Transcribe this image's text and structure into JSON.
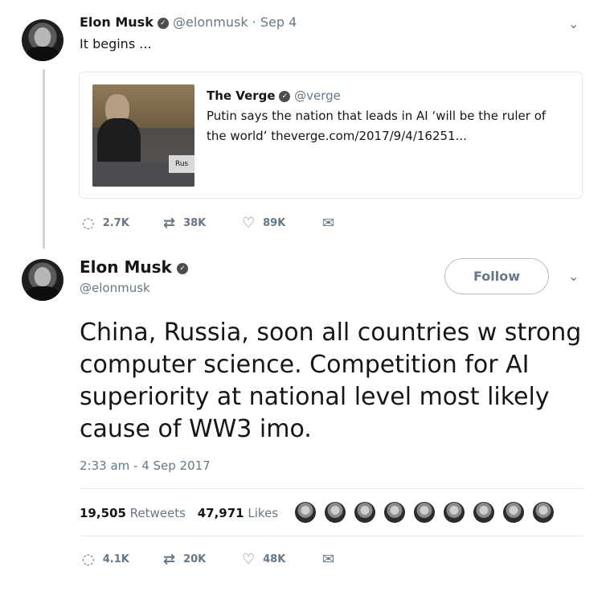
{
  "top_tweet": {
    "display_name": "Elon Musk",
    "handle": "@elonmusk",
    "separator": "·",
    "date": "Sep 4",
    "text": "It begins ...",
    "quoted": {
      "display_name": "The Verge",
      "handle": "@verge",
      "text": "Putin says the nation that leads in AI ‘will be the ruler of the world’ theverge.com/2017/9/4/16251...",
      "image_sign_text": "Rus"
    },
    "actions": {
      "replies": "2.7K",
      "retweets": "38K",
      "likes": "89K"
    }
  },
  "main_tweet": {
    "display_name": "Elon Musk",
    "handle": "@elonmusk",
    "follow_label": "Follow",
    "text": "China, Russia, soon all countries w strong computer science. Competition for AI superiority at national level most likely cause of WW3 imo.",
    "timestamp": "2:33 am - 4 Sep 2017",
    "stats": {
      "retweets_count": "19,505",
      "retweets_label": "Retweets",
      "likes_count": "47,971",
      "likes_label": "Likes"
    },
    "actions": {
      "replies": "4.1K",
      "retweets": "20K",
      "likes": "48K"
    }
  },
  "icons": {
    "verified": "verified-badge-icon",
    "reply": "reply-icon",
    "retweet": "retweet-icon",
    "like": "heart-icon",
    "message": "envelope-icon",
    "menu": "chevron-down-icon"
  },
  "colors": {
    "text": "#14171a",
    "muted": "#657786",
    "border": "#e1e8ed"
  }
}
